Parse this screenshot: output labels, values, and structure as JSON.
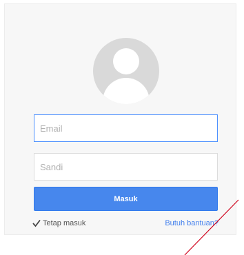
{
  "login": {
    "email_placeholder": "Email",
    "password_placeholder": "Sandi",
    "submit_label": "Masuk",
    "stay_signed_in_label": "Tetap masuk",
    "help_link_label": "Butuh bantuan?"
  },
  "colors": {
    "accent": "#4787ed",
    "annotation": "#d0021b"
  }
}
